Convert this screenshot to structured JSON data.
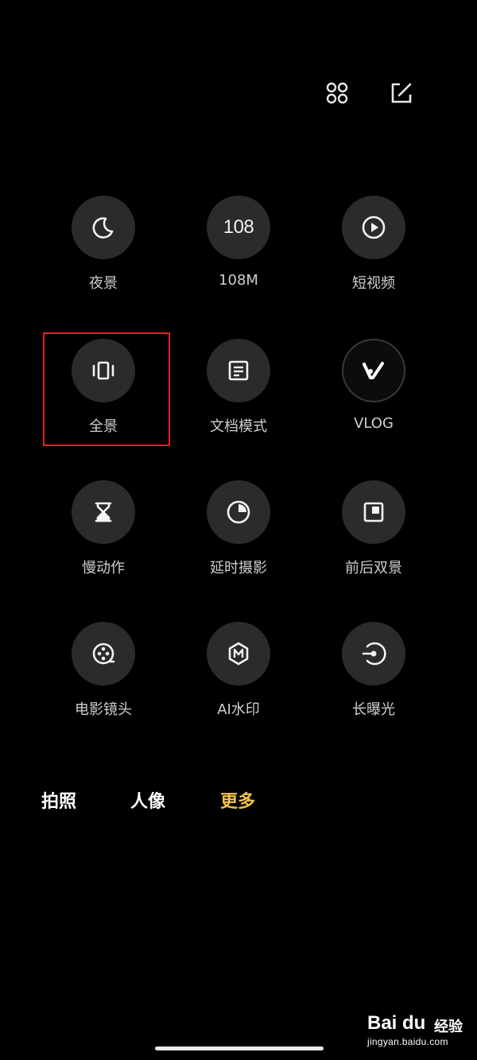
{
  "top_bar": {
    "icons": [
      "grid-icon",
      "edit-icon"
    ]
  },
  "modes": [
    {
      "label": "夜景",
      "icon": "moon-icon"
    },
    {
      "label": "108M",
      "icon": "108-icon",
      "icon_text": "108"
    },
    {
      "label": "短视频",
      "icon": "play-icon"
    },
    {
      "label": "全景",
      "icon": "panorama-icon"
    },
    {
      "label": "文档模式",
      "icon": "document-icon"
    },
    {
      "label": "VLOG",
      "icon": "vlog-icon"
    },
    {
      "label": "慢动作",
      "icon": "hourglass-icon"
    },
    {
      "label": "延时摄影",
      "icon": "timelapse-icon"
    },
    {
      "label": "前后双景",
      "icon": "dual-view-icon"
    },
    {
      "label": "电影镜头",
      "icon": "film-reel-icon"
    },
    {
      "label": "AI水印",
      "icon": "ai-watermark-icon"
    },
    {
      "label": "长曝光",
      "icon": "long-exposure-icon"
    }
  ],
  "highlighted_mode": "全景",
  "bottom_tabs": [
    {
      "label": "拍照",
      "active": false
    },
    {
      "label": "人像",
      "active": false
    },
    {
      "label": "更多",
      "active": true
    }
  ],
  "colors": {
    "background": "#000000",
    "circle": "#2b2b2b",
    "active_tab": "#f0c24b",
    "highlight_box": "#e02020",
    "vlog_accent": "#ffffff"
  },
  "watermark": {
    "logo": "Bai du",
    "text": "经验",
    "url": "jingyan.baidu.com"
  }
}
